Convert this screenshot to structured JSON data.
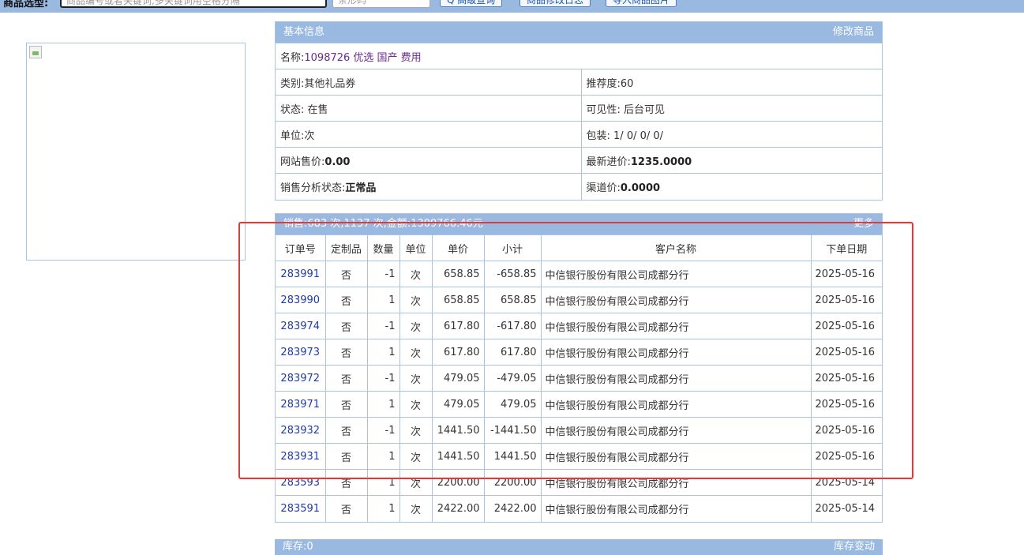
{
  "topbar": {
    "label": "商品选型:",
    "search_placeholder": "商品编号或者关键词,多关键词用空格分隔",
    "second_placeholder": "条形码",
    "buttons": [
      "Q 高级查询",
      "商品修改日志",
      "导入商品图片"
    ]
  },
  "basic_info": {
    "title": "基本信息",
    "edit_link": "修改商品",
    "name_label": "名称:",
    "name_value": "1098726 优选 国产 费用",
    "category_label": "类别:",
    "category_value": "其他礼品券",
    "recommend_label": "推荐度:",
    "recommend_value": "60",
    "status_label": "状态:",
    "status_value": "在售",
    "visibility_label": "可见性:",
    "visibility_value": "后台可见",
    "unit_label": "单位:",
    "unit_value": "次",
    "package_label": "包装:",
    "package_value": "1/ 0/ 0/ 0/",
    "site_price_label": "网站售价:",
    "site_price_value": "0.00",
    "latest_cost_label": "最新进价:",
    "latest_cost_value": "1235.0000",
    "analysis_label": "销售分析状态:",
    "analysis_value": "正常品",
    "channel_price_label": "渠道价:",
    "channel_price_value": "0.0000"
  },
  "sales": {
    "summary": "销售:683 次,1137 次,金额:1309766.46元",
    "more": "更多",
    "columns": [
      "订单号",
      "定制品",
      "数量",
      "单位",
      "单价",
      "小计",
      "客户名称",
      "下单日期"
    ],
    "rows": [
      {
        "order": "283991",
        "custom": "否",
        "qty": "-1",
        "unit": "次",
        "price": "658.85",
        "subtotal": "-658.85",
        "customer": "中信银行股份有限公司成都分行",
        "date": "2025-05-16"
      },
      {
        "order": "283990",
        "custom": "否",
        "qty": "1",
        "unit": "次",
        "price": "658.85",
        "subtotal": "658.85",
        "customer": "中信银行股份有限公司成都分行",
        "date": "2025-05-16"
      },
      {
        "order": "283974",
        "custom": "否",
        "qty": "-1",
        "unit": "次",
        "price": "617.80",
        "subtotal": "-617.80",
        "customer": "中信银行股份有限公司成都分行",
        "date": "2025-05-16"
      },
      {
        "order": "283973",
        "custom": "否",
        "qty": "1",
        "unit": "次",
        "price": "617.80",
        "subtotal": "617.80",
        "customer": "中信银行股份有限公司成都分行",
        "date": "2025-05-16"
      },
      {
        "order": "283972",
        "custom": "否",
        "qty": "-1",
        "unit": "次",
        "price": "479.05",
        "subtotal": "-479.05",
        "customer": "中信银行股份有限公司成都分行",
        "date": "2025-05-16"
      },
      {
        "order": "283971",
        "custom": "否",
        "qty": "1",
        "unit": "次",
        "price": "479.05",
        "subtotal": "479.05",
        "customer": "中信银行股份有限公司成都分行",
        "date": "2025-05-16"
      },
      {
        "order": "283932",
        "custom": "否",
        "qty": "-1",
        "unit": "次",
        "price": "1441.50",
        "subtotal": "-1441.50",
        "customer": "中信银行股份有限公司成都分行",
        "date": "2025-05-16"
      },
      {
        "order": "283931",
        "custom": "否",
        "qty": "1",
        "unit": "次",
        "price": "1441.50",
        "subtotal": "1441.50",
        "customer": "中信银行股份有限公司成都分行",
        "date": "2025-05-16"
      },
      {
        "order": "283593",
        "custom": "否",
        "qty": "1",
        "unit": "次",
        "price": "2200.00",
        "subtotal": "2200.00",
        "customer": "中信银行股份有限公司成都分行",
        "date": "2025-05-14"
      },
      {
        "order": "283591",
        "custom": "否",
        "qty": "1",
        "unit": "次",
        "price": "2422.00",
        "subtotal": "2422.00",
        "customer": "中信银行股份有限公司成都分行",
        "date": "2025-05-14"
      }
    ]
  },
  "stock": {
    "summary": "库存:0",
    "more": "库存变动"
  },
  "colors": {
    "header_blue": "#9ab9e0",
    "border_blue": "#a9c4e2",
    "link_blue": "#1f3aa8",
    "name_purple": "#6a2c91",
    "highlight_red": "#e53935"
  }
}
